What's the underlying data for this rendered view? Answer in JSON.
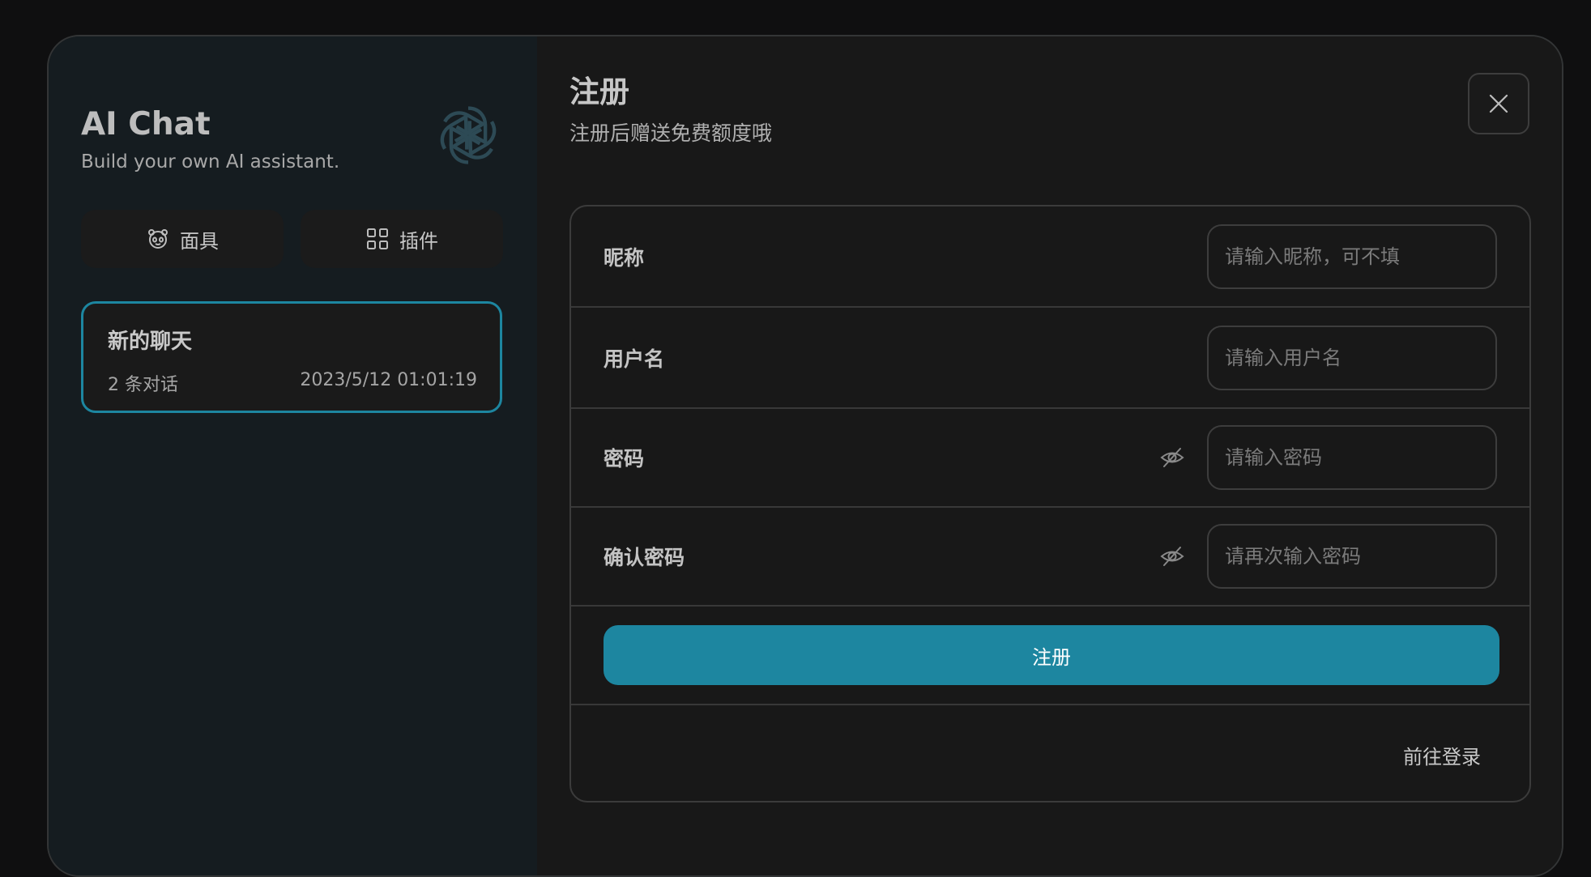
{
  "sidebar": {
    "title": "AI Chat",
    "subtitle": "Build your own AI assistant.",
    "mask_button": "面具",
    "plugin_button": "插件",
    "chat_items": [
      {
        "title": "新的聊天",
        "count": "2 条对话",
        "time": "2023/5/12 01:01:19"
      }
    ]
  },
  "main": {
    "title": "注册",
    "subtitle": "注册后赠送免费额度哦",
    "form": {
      "nickname": {
        "label": "昵称",
        "placeholder": "请输入昵称，可不填",
        "value": ""
      },
      "username": {
        "label": "用户名",
        "placeholder": "请输入用户名",
        "value": ""
      },
      "password": {
        "label": "密码",
        "placeholder": "请输入密码",
        "value": ""
      },
      "confirm": {
        "label": "确认密码",
        "placeholder": "请再次输入密码",
        "value": ""
      },
      "submit": "注册",
      "login_link": "前往登录"
    }
  },
  "colors": {
    "accent": "#1d86a0",
    "sidebar_bg": "#151c20",
    "main_bg": "#181818"
  },
  "icons": [
    "openai-logo-icon",
    "mask-icon",
    "plugin-grid-icon",
    "close-icon",
    "eye-off-icon"
  ]
}
